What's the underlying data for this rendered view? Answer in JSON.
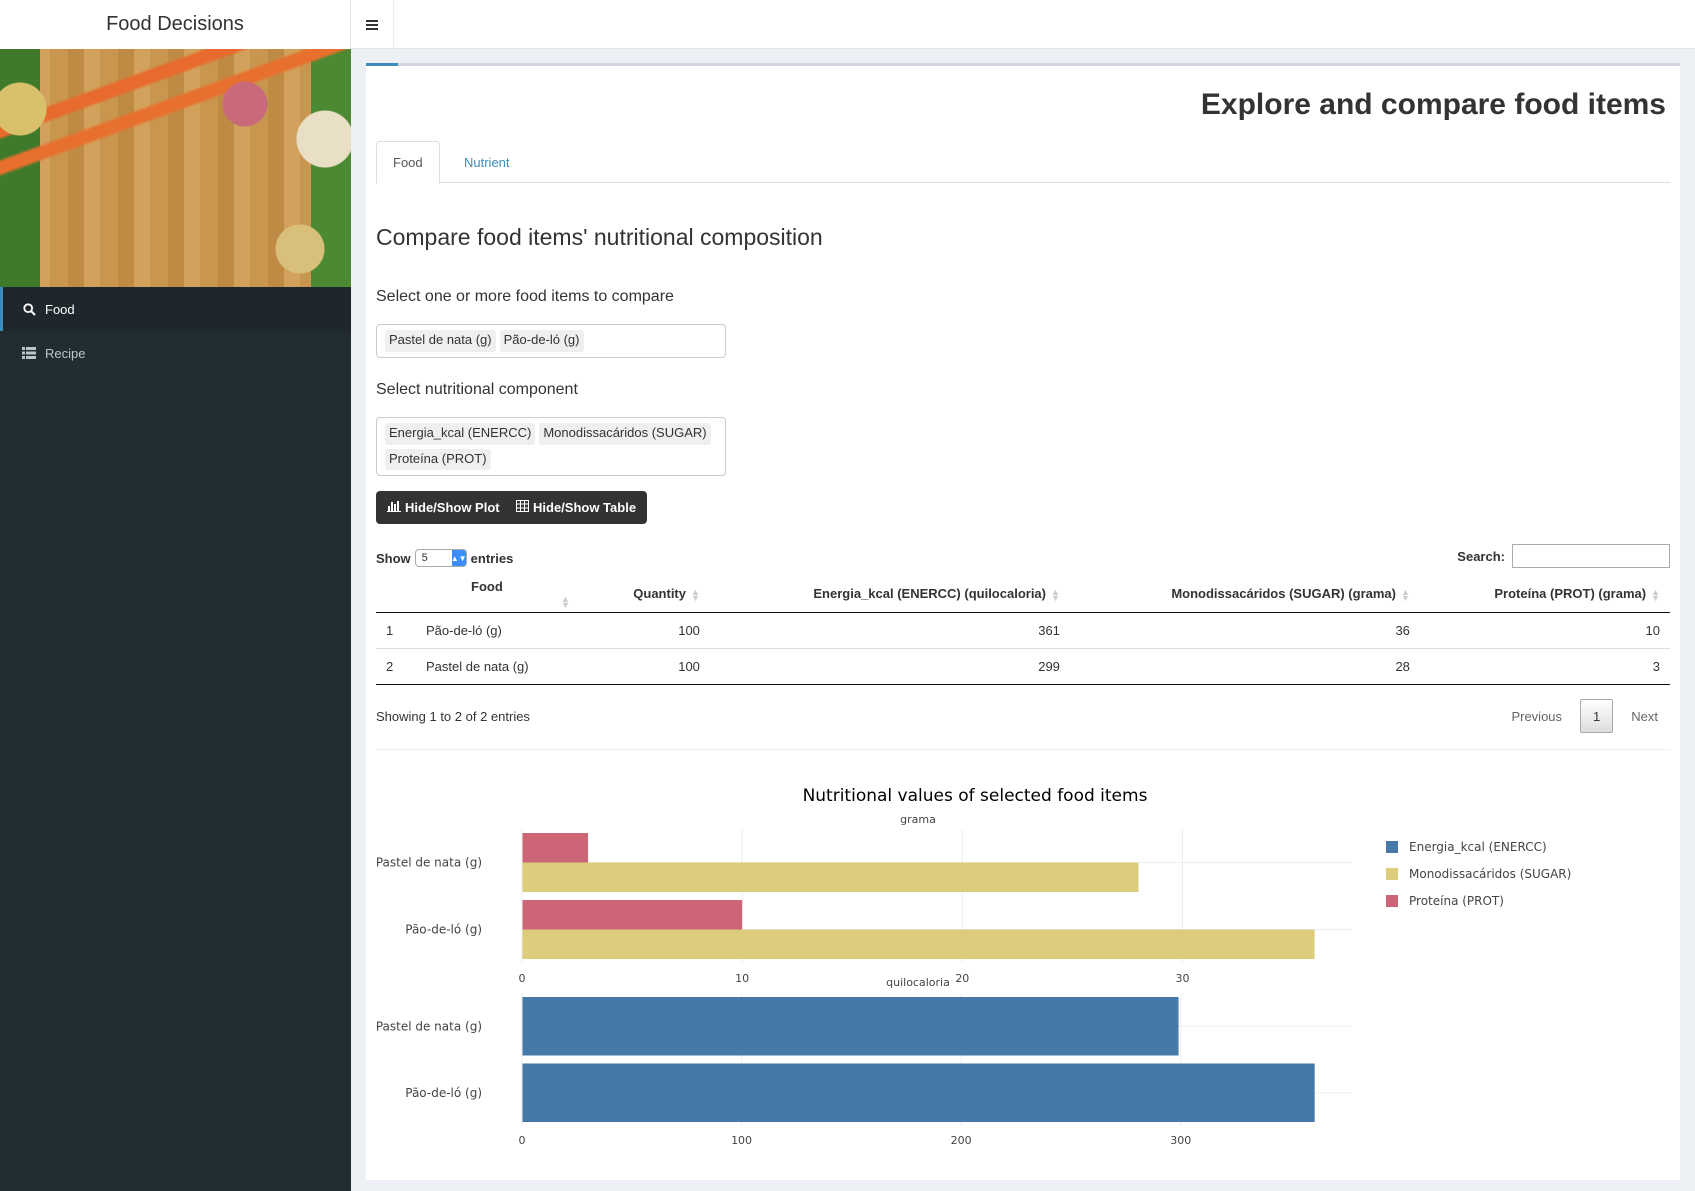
{
  "app": {
    "title": "Food Decisions"
  },
  "sidebar": {
    "items": [
      {
        "label": "Food",
        "icon": "search-icon",
        "active": true
      },
      {
        "label": "Recipe",
        "icon": "list-icon",
        "active": false
      }
    ]
  },
  "page": {
    "title": "Explore and compare food items",
    "tabs": [
      {
        "label": "Food"
      },
      {
        "label": "Nutrient"
      }
    ],
    "section_title": "Compare food items' nutritional composition",
    "food_select": {
      "label": "Select one or more food items to compare",
      "selected": [
        "Pastel de nata (g)",
        "Pão-de-ló (g)"
      ]
    },
    "nutrient_select": {
      "label": "Select nutritional component",
      "selected": [
        "Energia_kcal (ENERCC)",
        "Monodissacáridos (SUGAR)",
        "Proteína (PROT)"
      ]
    },
    "buttons": {
      "plot": "Hide/Show Plot",
      "table": "Hide/Show Table"
    }
  },
  "table": {
    "show_label": "Show",
    "entries_value": "5",
    "entries_label": "entries",
    "search_label": "Search:",
    "columns": [
      "",
      "Food",
      "Quantity",
      "Energia_kcal (ENERCC) (quilocaloria)",
      "Monodissacáridos (SUGAR) (grama)",
      "Proteína (PROT) (grama)"
    ],
    "rows": [
      [
        "1",
        "Pão-de-ló (g)",
        "100",
        "361",
        "36",
        "10"
      ],
      [
        "2",
        "Pastel de nata (g)",
        "100",
        "299",
        "28",
        "3"
      ]
    ],
    "info": "Showing 1 to 2 of 2 entries",
    "pagination": {
      "previous": "Previous",
      "current": "1",
      "next": "Next"
    }
  },
  "chart_data": {
    "type": "bar",
    "title": "Nutritional values of selected food items",
    "colors": {
      "Energia_kcal (ENERCC)": "#4678a8",
      "Monodissacáridos (SUGAR)": "#dccc7c",
      "Proteína (PROT)": "#cc6677"
    },
    "legend": [
      "Energia_kcal (ENERCC)",
      "Monodissacáridos (SUGAR)",
      "Proteína (PROT)"
    ],
    "legend_position": "right",
    "grid": true,
    "panels": [
      {
        "unit": "grama",
        "categories": [
          "Pastel de nata (g)",
          "Pão-de-ló (g)"
        ],
        "xlim": [
          0,
          37.7
        ],
        "ticks": [
          0,
          10,
          20,
          30
        ],
        "series": [
          {
            "name": "Monodissacáridos (SUGAR)",
            "values": [
              28,
              36
            ]
          },
          {
            "name": "Proteína (PROT)",
            "values": [
              3,
              10
            ]
          }
        ]
      },
      {
        "unit": "quilocaloria",
        "categories": [
          "Pastel de nata (g)",
          "Pão-de-ló (g)"
        ],
        "xlim": [
          0,
          378
        ],
        "ticks": [
          0,
          100,
          200,
          300
        ],
        "series": [
          {
            "name": "Energia_kcal (ENERCC)",
            "values": [
              299,
              361
            ]
          }
        ]
      }
    ]
  }
}
